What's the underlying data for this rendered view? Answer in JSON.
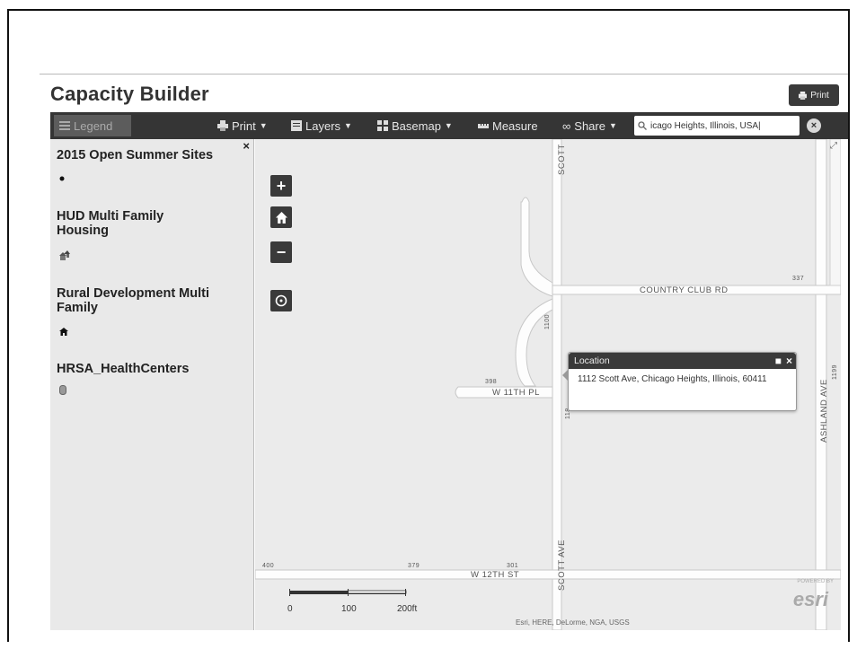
{
  "app": {
    "title": "Capacity Builder",
    "print_button": "Print"
  },
  "toolbar": {
    "legend": "Legend",
    "print": "Print",
    "layers": "Layers",
    "basemap": "Basemap",
    "measure": "Measure",
    "share": "Share",
    "search_value": "icago Heights, Illinois, USA|"
  },
  "legend": {
    "layers": [
      {
        "title": "2015 Open Summer Sites",
        "symbol": "dot-icon"
      },
      {
        "title": "HUD Multi Family Housing",
        "symbol": "houses-icon"
      },
      {
        "title": "Rural Development Multi Family",
        "symbol": "home-icon"
      },
      {
        "title": "HRSA_HealthCenters",
        "symbol": "health-center-icon"
      }
    ]
  },
  "map": {
    "zoom_in": "+",
    "zoom_out": "−",
    "streets": {
      "scott_ave_top": "SCOTT",
      "scott_ave": "SCOTT AVE",
      "country_club_rd": "COUNTRY CLUB RD",
      "ashland_ave": "ASHLAND AVE",
      "w_11th_pl": "W 11TH PL",
      "w_12th_st": "W 12TH ST"
    },
    "address_numbers": {
      "n337": "337",
      "n398": "398",
      "n400": "400",
      "n379": "379",
      "n301": "301",
      "n1100": "1100",
      "n1199": "1199",
      "n1118": "118",
      "n1101": "1101"
    },
    "scalebar": {
      "labels": [
        "0",
        "100",
        "200ft"
      ]
    },
    "attribution": "Esri, HERE, DeLorme, NGA, USGS",
    "logo": "esri",
    "powered_by": "POWERED BY"
  },
  "popup": {
    "title": "Location",
    "address": "1112 Scott Ave, Chicago Heights, Illinois, 60411"
  },
  "colors": {
    "toolbar_bg": "#353535",
    "map_bg": "#ebebeb",
    "sidebar_bg": "#e9e9e9",
    "road": "#fdfdfd"
  }
}
